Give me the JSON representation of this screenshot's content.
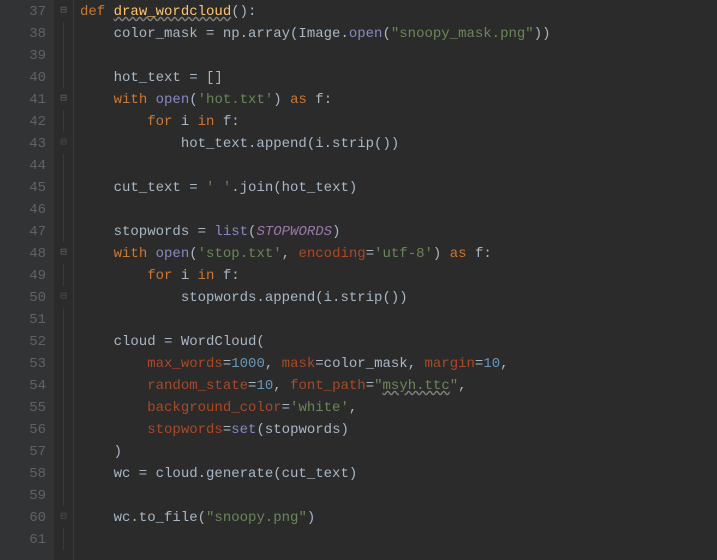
{
  "lines": [
    {
      "n": "37",
      "fold": "open",
      "segments": [
        {
          "t": "def ",
          "c": "kw"
        },
        {
          "t": "draw_wordcloud",
          "c": "fn wavy"
        },
        {
          "t": "():",
          "c": "punc"
        }
      ]
    },
    {
      "n": "38",
      "fold": "",
      "segments": [
        {
          "t": "    color_mask = np.array(Image.",
          "c": "ident"
        },
        {
          "t": "open",
          "c": "builtin"
        },
        {
          "t": "(",
          "c": "punc"
        },
        {
          "t": "\"snoopy_mask.png\"",
          "c": "str"
        },
        {
          "t": "))",
          "c": "punc"
        }
      ]
    },
    {
      "n": "39",
      "fold": "",
      "segments": [
        {
          "t": "",
          "c": "ident"
        }
      ]
    },
    {
      "n": "40",
      "fold": "",
      "segments": [
        {
          "t": "    hot_text = []",
          "c": "ident"
        }
      ]
    },
    {
      "n": "41",
      "fold": "open",
      "segments": [
        {
          "t": "    ",
          "c": "ident"
        },
        {
          "t": "with ",
          "c": "kw"
        },
        {
          "t": "open",
          "c": "builtin"
        },
        {
          "t": "(",
          "c": "punc"
        },
        {
          "t": "'hot.txt'",
          "c": "str"
        },
        {
          "t": ") ",
          "c": "punc"
        },
        {
          "t": "as ",
          "c": "kw"
        },
        {
          "t": "f:",
          "c": "ident"
        }
      ]
    },
    {
      "n": "42",
      "fold": "",
      "segments": [
        {
          "t": "        ",
          "c": "ident"
        },
        {
          "t": "for ",
          "c": "kw"
        },
        {
          "t": "i ",
          "c": "ident"
        },
        {
          "t": "in ",
          "c": "kw"
        },
        {
          "t": "f:",
          "c": "ident"
        }
      ]
    },
    {
      "n": "43",
      "fold": "close",
      "segments": [
        {
          "t": "            hot_text.append(i.strip())",
          "c": "ident"
        }
      ]
    },
    {
      "n": "44",
      "fold": "",
      "segments": [
        {
          "t": "",
          "c": "ident"
        }
      ]
    },
    {
      "n": "45",
      "fold": "",
      "segments": [
        {
          "t": "    cut_text = ",
          "c": "ident"
        },
        {
          "t": "' '",
          "c": "str"
        },
        {
          "t": ".join(hot_text)",
          "c": "ident"
        }
      ]
    },
    {
      "n": "46",
      "fold": "",
      "segments": [
        {
          "t": "",
          "c": "ident"
        }
      ]
    },
    {
      "n": "47",
      "fold": "",
      "segments": [
        {
          "t": "    stopwords = ",
          "c": "ident"
        },
        {
          "t": "list",
          "c": "builtin"
        },
        {
          "t": "(",
          "c": "punc"
        },
        {
          "t": "STOPWORDS",
          "c": "const"
        },
        {
          "t": ")",
          "c": "punc"
        }
      ]
    },
    {
      "n": "48",
      "fold": "open",
      "segments": [
        {
          "t": "    ",
          "c": "ident"
        },
        {
          "t": "with ",
          "c": "kw"
        },
        {
          "t": "open",
          "c": "builtin"
        },
        {
          "t": "(",
          "c": "punc"
        },
        {
          "t": "'stop.txt'",
          "c": "str"
        },
        {
          "t": ", ",
          "c": "punc"
        },
        {
          "t": "encoding",
          "c": "param"
        },
        {
          "t": "=",
          "c": "punc"
        },
        {
          "t": "'utf-8'",
          "c": "str"
        },
        {
          "t": ") ",
          "c": "punc"
        },
        {
          "t": "as ",
          "c": "kw"
        },
        {
          "t": "f:",
          "c": "ident"
        }
      ]
    },
    {
      "n": "49",
      "fold": "",
      "segments": [
        {
          "t": "        ",
          "c": "ident"
        },
        {
          "t": "for ",
          "c": "kw"
        },
        {
          "t": "i ",
          "c": "ident"
        },
        {
          "t": "in ",
          "c": "kw"
        },
        {
          "t": "f:",
          "c": "ident"
        }
      ]
    },
    {
      "n": "50",
      "fold": "close",
      "segments": [
        {
          "t": "            stopwords.append(i.strip())",
          "c": "ident"
        }
      ]
    },
    {
      "n": "51",
      "fold": "",
      "segments": [
        {
          "t": "",
          "c": "ident"
        }
      ]
    },
    {
      "n": "52",
      "fold": "",
      "segments": [
        {
          "t": "    cloud = WordCloud(",
          "c": "ident"
        }
      ]
    },
    {
      "n": "53",
      "fold": "",
      "segments": [
        {
          "t": "        ",
          "c": "ident"
        },
        {
          "t": "max_words",
          "c": "param"
        },
        {
          "t": "=",
          "c": "punc"
        },
        {
          "t": "1000",
          "c": "num"
        },
        {
          "t": ", ",
          "c": "punc"
        },
        {
          "t": "mask",
          "c": "param"
        },
        {
          "t": "=color_mask, ",
          "c": "ident"
        },
        {
          "t": "margin",
          "c": "param"
        },
        {
          "t": "=",
          "c": "punc"
        },
        {
          "t": "10",
          "c": "num"
        },
        {
          "t": ",",
          "c": "punc"
        }
      ]
    },
    {
      "n": "54",
      "fold": "",
      "segments": [
        {
          "t": "        ",
          "c": "ident"
        },
        {
          "t": "random_state",
          "c": "param"
        },
        {
          "t": "=",
          "c": "punc"
        },
        {
          "t": "10",
          "c": "num"
        },
        {
          "t": ", ",
          "c": "punc"
        },
        {
          "t": "font_path",
          "c": "param"
        },
        {
          "t": "=",
          "c": "punc"
        },
        {
          "t": "\"",
          "c": "str"
        },
        {
          "t": "msyh.ttc",
          "c": "str wavy"
        },
        {
          "t": "\"",
          "c": "str"
        },
        {
          "t": ",",
          "c": "punc"
        }
      ]
    },
    {
      "n": "55",
      "fold": "",
      "segments": [
        {
          "t": "        ",
          "c": "ident"
        },
        {
          "t": "background_color",
          "c": "param"
        },
        {
          "t": "=",
          "c": "punc"
        },
        {
          "t": "'white'",
          "c": "str"
        },
        {
          "t": ",",
          "c": "punc"
        }
      ]
    },
    {
      "n": "56",
      "fold": "",
      "segments": [
        {
          "t": "        ",
          "c": "ident"
        },
        {
          "t": "stopwords",
          "c": "param"
        },
        {
          "t": "=",
          "c": "punc"
        },
        {
          "t": "set",
          "c": "builtin"
        },
        {
          "t": "(stopwords)",
          "c": "ident"
        }
      ]
    },
    {
      "n": "57",
      "fold": "",
      "segments": [
        {
          "t": "    )",
          "c": "ident"
        }
      ]
    },
    {
      "n": "58",
      "fold": "",
      "segments": [
        {
          "t": "    wc = cloud.generate(cut_text)",
          "c": "ident"
        }
      ]
    },
    {
      "n": "59",
      "fold": "",
      "segments": [
        {
          "t": "",
          "c": "ident"
        }
      ]
    },
    {
      "n": "60",
      "fold": "close",
      "segments": [
        {
          "t": "    wc.to_file(",
          "c": "ident"
        },
        {
          "t": "\"snoopy.png\"",
          "c": "str"
        },
        {
          "t": ")",
          "c": "ident"
        }
      ]
    },
    {
      "n": "61",
      "fold": "",
      "segments": [
        {
          "t": "",
          "c": "ident"
        }
      ]
    }
  ],
  "fold_glyphs": {
    "open": "⊟",
    "close": "⊟"
  }
}
